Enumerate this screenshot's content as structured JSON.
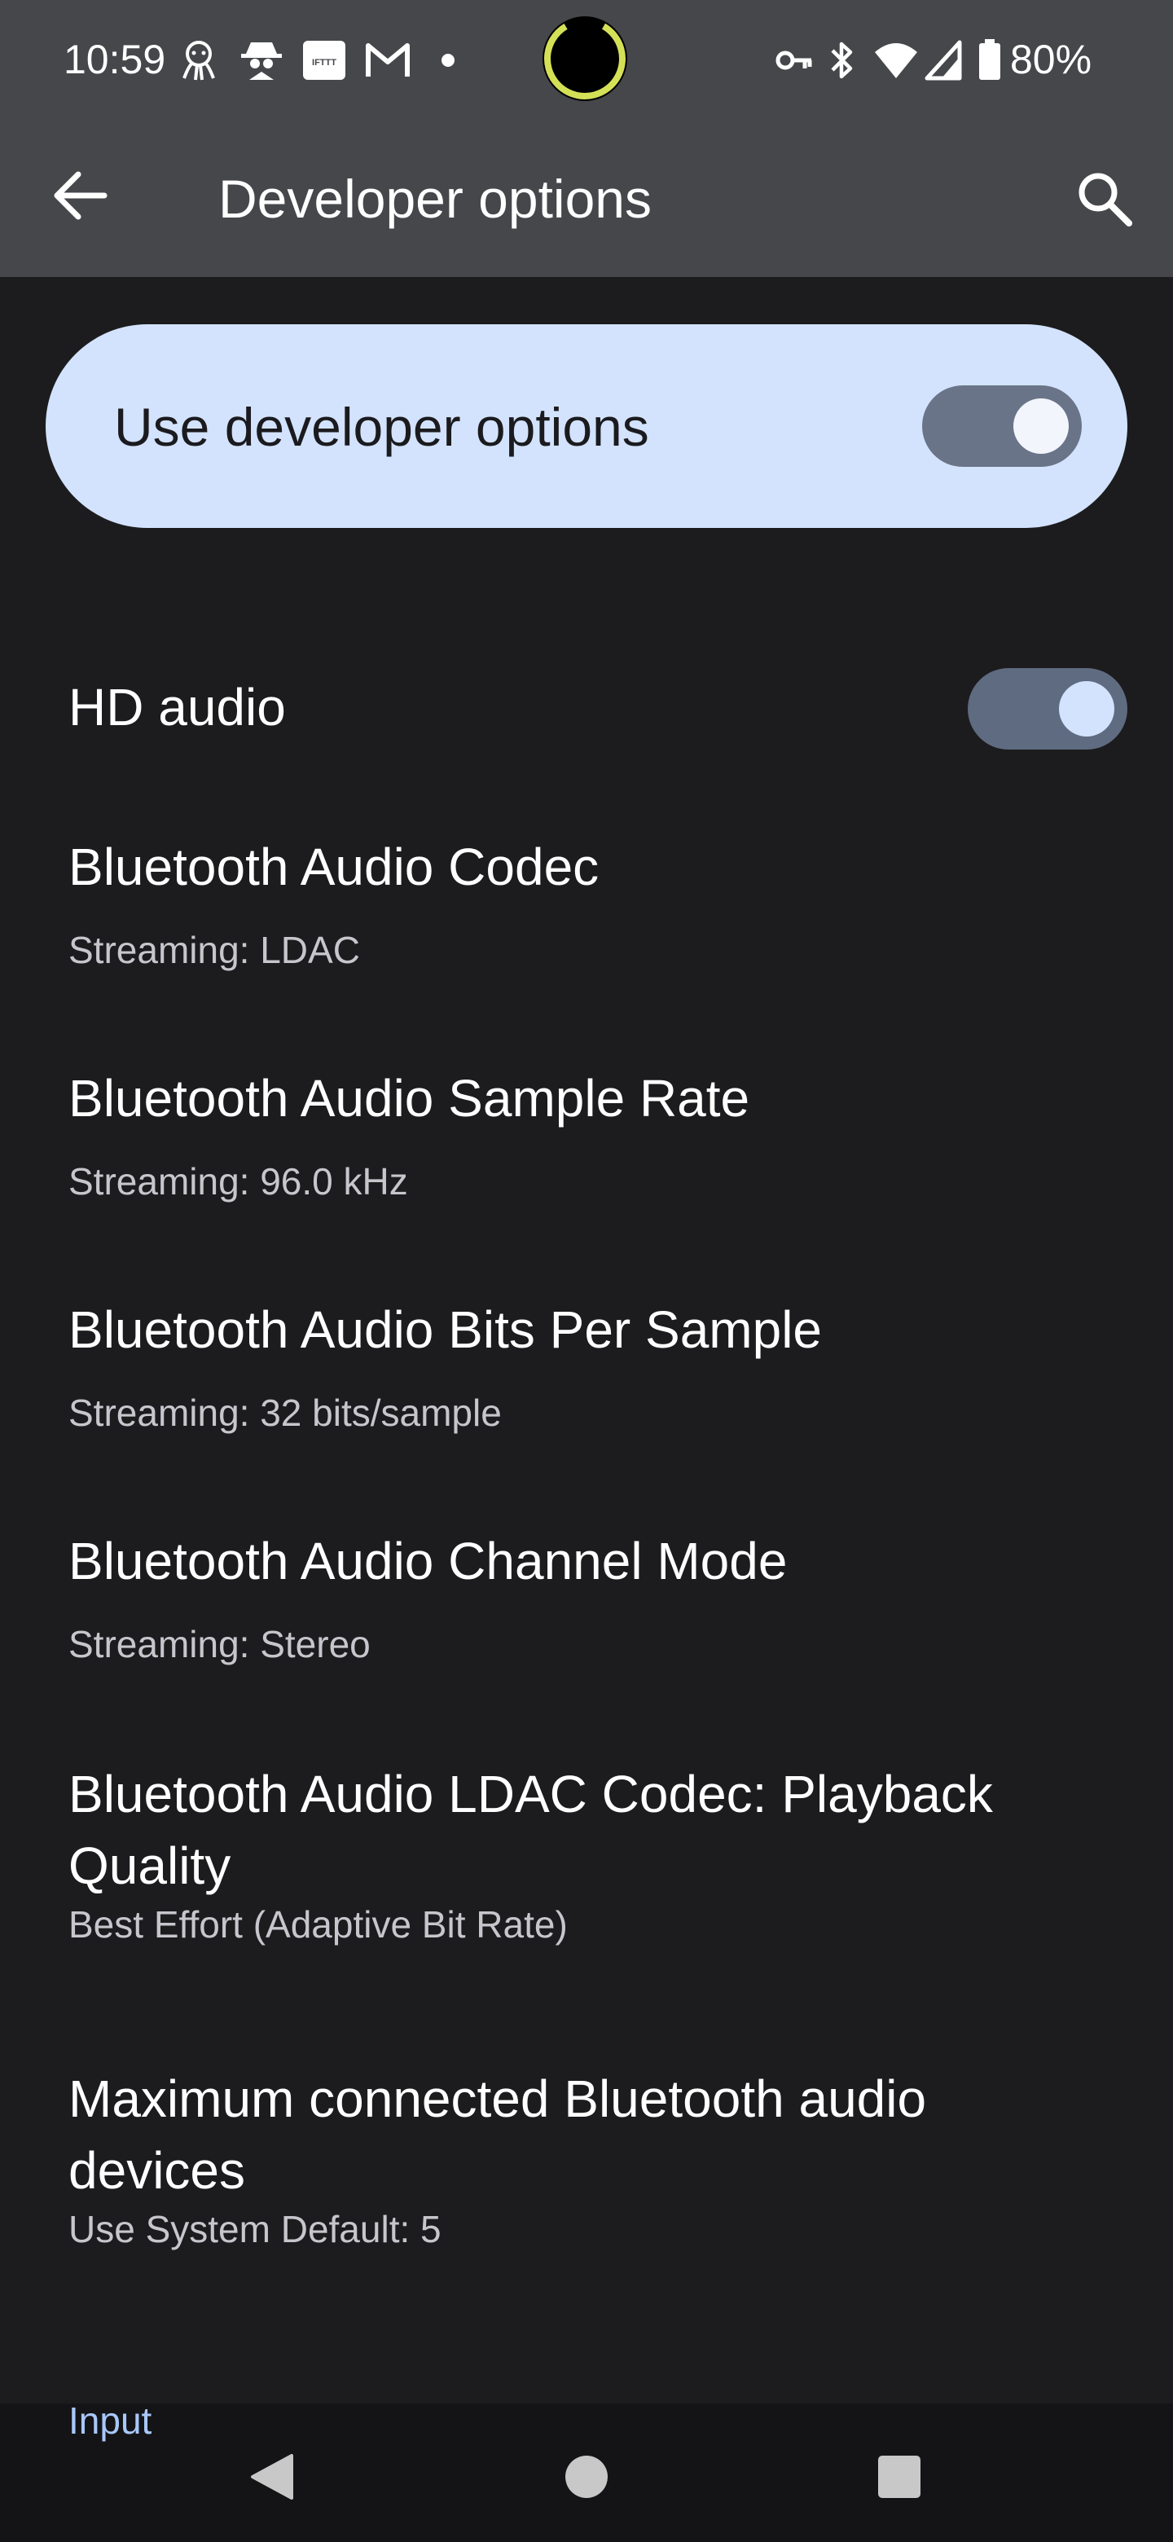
{
  "status_bar": {
    "time": "10:59",
    "battery": "80%",
    "icons": [
      "octopus-icon",
      "spy-icon",
      "ifttt-icon",
      "gmail-icon",
      "dot-icon",
      "vpn-key-icon",
      "bluetooth-icon",
      "wifi-icon",
      "cell-signal-icon",
      "battery-icon"
    ],
    "ifttt_text": "IFTTT"
  },
  "app_bar": {
    "title": "Developer options",
    "back_icon": "arrow-back-icon",
    "search_icon": "search-icon"
  },
  "master_toggle": {
    "label": "Use developer options",
    "on": true
  },
  "settings": {
    "hd_audio": {
      "title": "HD audio",
      "on": true
    },
    "items": [
      {
        "title": "Bluetooth Audio Codec",
        "subtitle": "Streaming: LDAC"
      },
      {
        "title": "Bluetooth Audio Sample Rate",
        "subtitle": "Streaming: 96.0 kHz"
      },
      {
        "title": "Bluetooth Audio Bits Per Sample",
        "subtitle": "Streaming: 32 bits/sample"
      },
      {
        "title": "Bluetooth Audio Channel Mode",
        "subtitle": "Streaming: Stereo"
      },
      {
        "title_line1": "Bluetooth Audio LDAC Codec: Playback",
        "title_line2": "Quality",
        "subtitle": "Best Effort (Adaptive Bit Rate)"
      },
      {
        "title_line1": "Maximum connected Bluetooth audio",
        "title_line2": "devices",
        "subtitle": "Use System Default: 5"
      }
    ],
    "next_section": "Input"
  },
  "nav_bar": {
    "buttons": [
      "back-triangle-icon",
      "home-circle-icon",
      "recents-square-icon"
    ]
  },
  "colors": {
    "app_bar": "#46474b",
    "background": "#1c1c1e",
    "card": "#d3e3fd",
    "switch_track": "#5f6b80",
    "accent_header": "#a8c7fa"
  }
}
